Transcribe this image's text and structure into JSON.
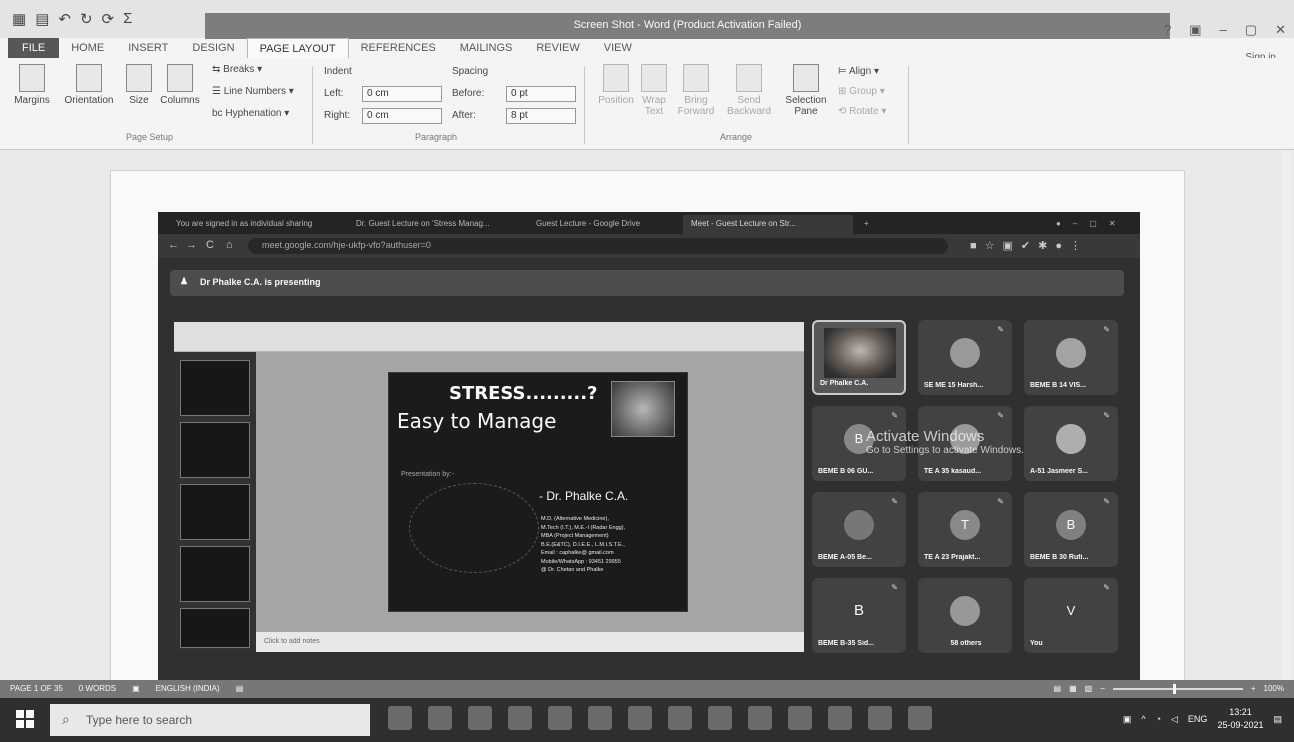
{
  "word": {
    "title": "Screen Shot - Word (Product Activation Failed)",
    "qat_icons": [
      "save-icon",
      "undo-icon",
      "redo-icon",
      "sum-icon"
    ],
    "window_controls": [
      "?",
      "▢",
      "–",
      "▢",
      "✕"
    ],
    "signin": "Sign in",
    "tabs": [
      "FILE",
      "HOME",
      "INSERT",
      "DESIGN",
      "PAGE LAYOUT",
      "REFERENCES",
      "MAILINGS",
      "REVIEW",
      "VIEW"
    ],
    "active_tab": "PAGE LAYOUT",
    "ribbon": {
      "margins": "Margins",
      "orientation": "Orientation",
      "size": "Size",
      "columns": "Columns",
      "breaks": "Breaks",
      "line_numbers": "Line Numbers",
      "hyphenation": "Hyphenation",
      "page_setup": "Page Setup",
      "indent": "Indent",
      "left": "Left:",
      "left_value": "0 cm",
      "right": "Right:",
      "right_value": "0 cm",
      "spacing": "Spacing",
      "before": "Before:",
      "before_value": "0 pt",
      "after": "After:",
      "after_value": "8 pt",
      "paragraph": "Paragraph",
      "position": "Position",
      "wrap_text": "Wrap Text",
      "bring_forward": "Bring Forward",
      "send_backward": "Send Backward",
      "selection_pane": "Selection Pane",
      "align": "Align",
      "group": "Group",
      "rotate": "Rotate",
      "arrange": "Arrange"
    },
    "status": {
      "page": "PAGE 1 OF 35",
      "words": "0 WORDS",
      "language": "ENGLISH (INDIA)",
      "zoom": "100%"
    }
  },
  "browser": {
    "tabs": [
      "You are signed in as individual sharing",
      "Dr. Guest Lecture on 'Stress Manag...",
      "Guest Lecture - Google Drive",
      "Meet - Guest Lecture on Str..."
    ],
    "url": "meet.google.com/hje-ukfp-vfo?authuser=0"
  },
  "meet": {
    "presenting": "Dr Phalke C.A. is presenting",
    "tiles": [
      {
        "label": "Dr Phalke C.A.",
        "initial": ""
      },
      {
        "label": "SE ME 15 Harsh...",
        "initial": ""
      },
      {
        "label": "BEME B 14 VIS...",
        "initial": ""
      },
      {
        "label": "BEME B 06 GU...",
        "initial": "B"
      },
      {
        "label": "TE A 35 kasaud...",
        "initial": ""
      },
      {
        "label": "A-51 Jasmeer S...",
        "initial": ""
      },
      {
        "label": "BEME A-05 Be...",
        "initial": ""
      },
      {
        "label": "TE A 23 Prajakt...",
        "initial": "T"
      },
      {
        "label": "BEME B 30 Ruti...",
        "initial": "B"
      },
      {
        "label": "BEME B-35 Sid...",
        "initial": "B"
      },
      {
        "label": "58 others",
        "initial": ""
      },
      {
        "label": "You",
        "initial": "V"
      }
    ],
    "activate_line1": "Activate Windows",
    "activate_line2": "Go to Settings to activate Windows."
  },
  "slide": {
    "title": "STRESS.........?",
    "subtitle": "Easy to Manage",
    "by": "Presentation by:-",
    "name": "- Dr. Phalke C.A.",
    "quals": [
      "M.D. (Alternative Medicine),",
      "M.Tech (I.T.), M.E.-I (Radar Engg),",
      "MBA (Project Management)",
      "B.E.(E&TC), D.I.E.E., L.M.I.S.T.E.,",
      "Email : caphalke@ gmail.com",
      "Mobile/WhatsApp : 93451 29955",
      "@ Dr. Chetan and Phalke"
    ],
    "notes": "Click to add notes"
  },
  "taskbar": {
    "search_placeholder": "Type here to search",
    "language": "ENG",
    "time": "13:21",
    "date": "25-09-2021"
  }
}
